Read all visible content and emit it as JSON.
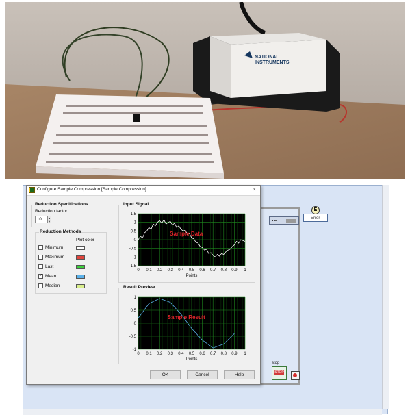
{
  "photo": {
    "device_logo_line1": "NATIONAL",
    "device_logo_line2": "INSTRUMENTS"
  },
  "dialog": {
    "title": "Configure Sample Compression [Sample Compression]",
    "close_glyph": "×",
    "reduction_spec": {
      "title": "Reduction Specifications",
      "factor_label": "Reduction factor",
      "factor_value": "10"
    },
    "reduction_methods": {
      "title": "Reduction Methods",
      "plot_color_label": "Plot color",
      "items": [
        {
          "label": "Minimum",
          "checked": false,
          "color": "#ffffff"
        },
        {
          "label": "Maximum",
          "checked": false,
          "color": "#e0443c"
        },
        {
          "label": "Last",
          "checked": false,
          "color": "#3ccf3c"
        },
        {
          "label": "Mean",
          "checked": true,
          "color": "#5ab0e8"
        },
        {
          "label": "Median",
          "checked": false,
          "color": "#d8ee8c"
        }
      ]
    },
    "input_signal": {
      "title": "Input Signal",
      "overlay": "Sample Data",
      "xlabel": "Points"
    },
    "result_preview": {
      "title": "Result Preview",
      "overlay": "Sample Result",
      "xlabel": "Points"
    },
    "buttons": {
      "ok": "OK",
      "cancel": "Cancel",
      "help": "Help"
    }
  },
  "diagram": {
    "node_label": "▪ ▪▪",
    "error_label": "Error",
    "error_icon_letter": "E",
    "stop_label": "stop",
    "stop_button_text": "STOP"
  },
  "chart_data": [
    {
      "type": "line",
      "title": "Input Signal",
      "xlabel": "Points",
      "ylabel": "",
      "xlim": [
        0,
        1
      ],
      "ylim": [
        -1.5,
        1.5
      ],
      "x_ticks": [
        "0",
        "0.1",
        "0.2",
        "0.3",
        "0.4",
        "0.5",
        "0.6",
        "0.7",
        "0.8",
        "0.9",
        "1"
      ],
      "y_ticks": [
        "1.5",
        "1",
        "0.5",
        "0",
        "-0.5",
        "-1",
        "-1.5"
      ],
      "annotation": "Sample Data",
      "series": [
        {
          "color": "#ffffff",
          "x": [
            0,
            0.02,
            0.04,
            0.06,
            0.08,
            0.1,
            0.12,
            0.14,
            0.16,
            0.18,
            0.2,
            0.22,
            0.24,
            0.26,
            0.28,
            0.3,
            0.32,
            0.34,
            0.36,
            0.38,
            0.4,
            0.42,
            0.44,
            0.46,
            0.48,
            0.5,
            0.52,
            0.54,
            0.56,
            0.58,
            0.6,
            0.62,
            0.64,
            0.66,
            0.68,
            0.7,
            0.72,
            0.74,
            0.76,
            0.78,
            0.8,
            0.82,
            0.84,
            0.86,
            0.88,
            0.9,
            0.92,
            0.94,
            0.96,
            0.98,
            1.0
          ],
          "y": [
            0.0,
            0.2,
            0.1,
            0.4,
            0.5,
            0.7,
            0.6,
            0.9,
            0.8,
            1.0,
            1.1,
            0.95,
            1.15,
            0.9,
            1.0,
            1.05,
            0.85,
            0.95,
            0.7,
            0.8,
            0.6,
            0.5,
            0.55,
            0.3,
            0.35,
            0.1,
            0.05,
            -0.15,
            -0.2,
            -0.4,
            -0.45,
            -0.6,
            -0.55,
            -0.8,
            -0.75,
            -0.9,
            -1.0,
            -0.85,
            -0.95,
            -0.8,
            -0.85,
            -0.7,
            -0.6,
            -0.55,
            -0.4,
            -0.3,
            -0.1,
            -0.2,
            0.0,
            -0.05,
            -0.1
          ]
        }
      ]
    },
    {
      "type": "line",
      "title": "Result Preview",
      "xlabel": "Points",
      "ylabel": "",
      "xlim": [
        0,
        1
      ],
      "ylim": [
        -1,
        1
      ],
      "x_ticks": [
        "0",
        "0.1",
        "0.2",
        "0.3",
        "0.4",
        "0.5",
        "0.6",
        "0.7",
        "0.8",
        "0.9",
        "1"
      ],
      "y_ticks": [
        "1",
        "0.5",
        "0",
        "-0.5",
        "-1"
      ],
      "annotation": "Sample Result",
      "series": [
        {
          "color": "#5ab0e8",
          "x": [
            0,
            0.1,
            0.2,
            0.3,
            0.4,
            0.5,
            0.6,
            0.7,
            0.8,
            0.9
          ],
          "y": [
            0.2,
            0.75,
            0.95,
            0.8,
            0.35,
            -0.2,
            -0.65,
            -0.95,
            -0.8,
            -0.4
          ]
        }
      ]
    }
  ]
}
